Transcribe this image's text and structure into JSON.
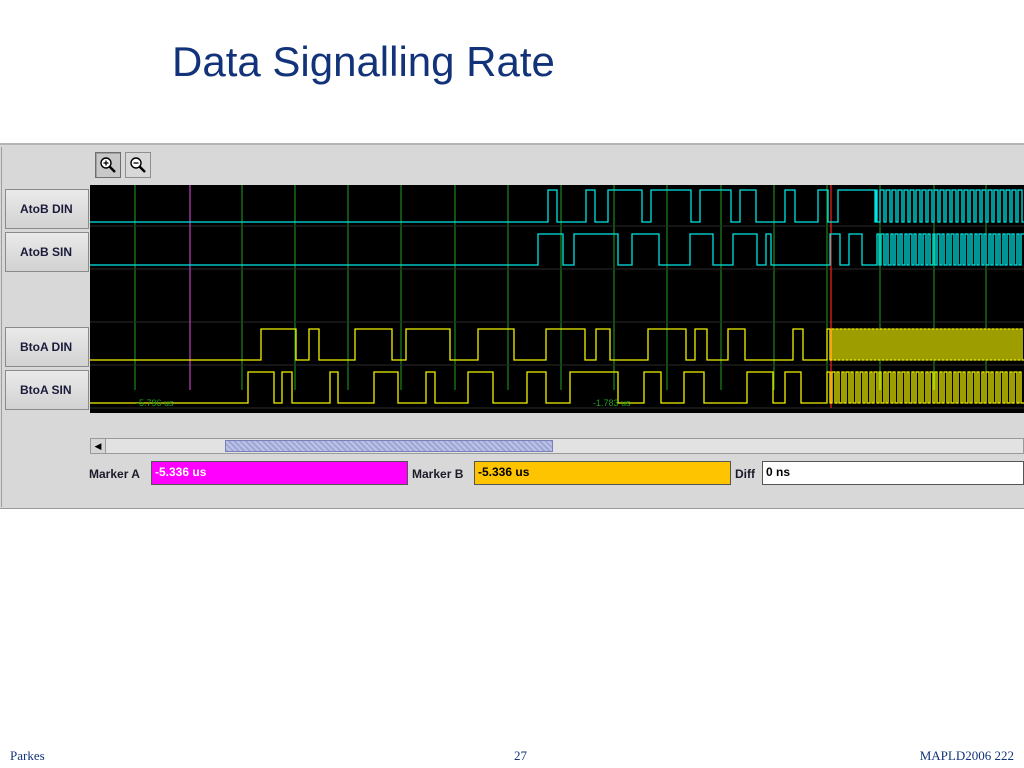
{
  "slide": {
    "title": "Data Signalling Rate",
    "footer_left": "Parkes",
    "footer_center": "27",
    "footer_right": "MAPLD2006 222"
  },
  "toolbar": {
    "zoom_in_icon": "zoom-in-icon",
    "zoom_out_icon": "zoom-out-icon"
  },
  "signals": [
    {
      "label": "AtoB DIN",
      "color": "#00e5e5"
    },
    {
      "label": "AtoB SIN",
      "color": "#00e5e5"
    },
    {
      "label": "BtoA DIN",
      "color": "#f2f200"
    },
    {
      "label": "BtoA SIN",
      "color": "#f2f200"
    }
  ],
  "time_axis": {
    "left_label": "-5.796 us",
    "mid_label": "-1.783 us"
  },
  "markers": {
    "a_label": "Marker A",
    "a_value": "-5.336 us",
    "a_color": "#ff00ff",
    "b_label": "Marker B",
    "b_value": "-5.336 us",
    "b_color": "#ffc400",
    "diff_label": "Diff",
    "diff_value": "0 ns"
  },
  "colors": {
    "grid": "#1f9f1f",
    "marker_a_line": "#c040c0",
    "marker_b_line": "#ff2020",
    "background": "#000000"
  }
}
